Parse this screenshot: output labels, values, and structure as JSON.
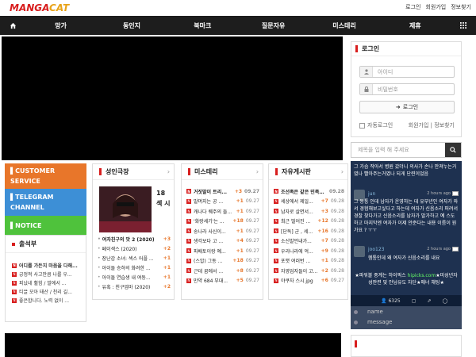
{
  "header": {
    "logo_text_a": "MANGA",
    "logo_text_b": "CAT",
    "links": [
      "로그인",
      "회원가입",
      "정보찾기"
    ]
  },
  "nav": {
    "items": [
      "망가",
      "동인지",
      "북마크",
      "질문자유",
      "미스테리",
      "제휴"
    ]
  },
  "login": {
    "title": "로그인",
    "id_placeholder": "아이디",
    "pw_placeholder": "비밀번호",
    "button": "로그인",
    "auto_login": "자동로그인",
    "register": "회원가입",
    "find": "정보찾기"
  },
  "chat": {
    "search_placeholder": "제목을 입력 해 주세요",
    "messages": [
      {
        "text": "그 가슴 작아서 병원 갔더니 의사가 손나 만져누는거였나 빨아주는거였나 되게 단련이었음"
      },
      {
        "name": "jun",
        "time": "2 hours ago",
        "text": "그 동통 인데 남자가 운영하는 데 유부년인 여자가 와서 경험해보고싶다고 하는데 여자가 신음소리 퍼려서 경찰 찾다가고 신음소리를 남자가 말가하고 예 스도하고 마지막엔 여자가 이제 안준다는 내용 이름이 뭔가요 ? ㅜㅜ"
      },
      {
        "name": "joo123",
        "time": "2 hours ago",
        "text": "헴통인데 왜 여자가 신음소리를 내요"
      },
      {
        "note_a": "★파워볼 중계는 하이픽스 ",
        "note_link": "hipicks.com",
        "note_b": "★미성년자 성판련 및 안남유도 차단★매너 채팅★"
      }
    ],
    "user_count": "6325",
    "form_name": "name",
    "form_message": "message"
  },
  "side_menu": {
    "customer": "CUSTOMER SERVICE",
    "telegram": "TELEGRAM CHANNEL",
    "notice": "NOTICE"
  },
  "attendance": {
    "title": "출석부",
    "items": [
      "어디를 가든지 마음을 다해...",
      "긍정적 사고만큼 나를 우...",
      "피났네 휠힘 / 발에서 ...",
      "티끌 모아 태산 / 천리 길...",
      "좋은합니다. 노력 없이 ..."
    ]
  },
  "boards": {
    "b1": {
      "title": "성인극장",
      "feature_title": "18 섹 시",
      "items": [
        {
          "t": "여자친구의 맛 2 (2020)",
          "c": "+3",
          "bold": true
        },
        {
          "t": "페이섹스 (2020)",
          "c": "+2"
        },
        {
          "t": "장난감 소녀: 섹스 어플 ...",
          "c": "+1"
        },
        {
          "t": "아이돌 승하의 화려한 ...",
          "c": "+1"
        },
        {
          "t": "아이돌 연습생 내 여동...",
          "c": "+1"
        },
        {
          "t": "유혹 : 친구엄마 (2020)",
          "c": "+2"
        }
      ]
    },
    "b2": {
      "title": "미스테리",
      "items": [
        {
          "t": "거짓말이 트리...",
          "c": "+3",
          "d": "09.27"
        },
        {
          "t": "말머지는 공 ...",
          "c": "+1",
          "d": "09.27"
        },
        {
          "t": "캐나다 퀘주의 들...",
          "c": "+1",
          "d": "09.27"
        },
        {
          "t": "'화랑세기'는 ...",
          "c": "+18",
          "d": "09.27"
        },
        {
          "t": "송나라 사신이...",
          "c": "+1",
          "d": "09.27"
        },
        {
          "t": "생각보다 고 ...",
          "c": "+4",
          "d": "09.27"
        },
        {
          "t": "파배토이랑 예...",
          "c": "+1",
          "d": "09.27"
        },
        {
          "t": "(스압) 그동 ...",
          "c": "+18",
          "d": "09.27"
        },
        {
          "t": "근데 꿈에서 ...",
          "c": "+8",
          "d": "09.27"
        },
        {
          "t": "만약 684 부대...",
          "c": "+5",
          "d": "09.27"
        }
      ]
    },
    "b3": {
      "title": "자유게시판",
      "items": [
        {
          "t": "조선족은 같은 민족...",
          "c": "",
          "d": "09.28"
        },
        {
          "t": "세상에서 제일...",
          "c": "+7",
          "d": "09.28"
        },
        {
          "t": "남자로 살면서...",
          "c": "+3",
          "d": "09.28"
        },
        {
          "t": "최근 벌어진 ...",
          "c": "+12",
          "d": "09.28"
        },
        {
          "t": "[단독] 군 , 세...",
          "c": "+16",
          "d": "09.28"
        },
        {
          "t": "소신발언내가...",
          "c": "+7",
          "d": "09.28"
        },
        {
          "t": "우리나라에 억...",
          "c": "+9",
          "d": "09.28"
        },
        {
          "t": "포맷 여러번 ...",
          "c": "+1",
          "d": "09.28"
        },
        {
          "t": "자영업자들이 고...",
          "c": "+2",
          "d": "09.28"
        },
        {
          "t": "야쿠자 스시.jpg",
          "c": "+6",
          "d": "09.27"
        }
      ]
    }
  },
  "colors": {
    "nav_bg": "#1d1d1d",
    "accent": "#d81e1e",
    "customer": "#e8762a",
    "telegram": "#3d8fd6",
    "notice": "#4fc23c",
    "chat_bg": "#1e3150"
  }
}
